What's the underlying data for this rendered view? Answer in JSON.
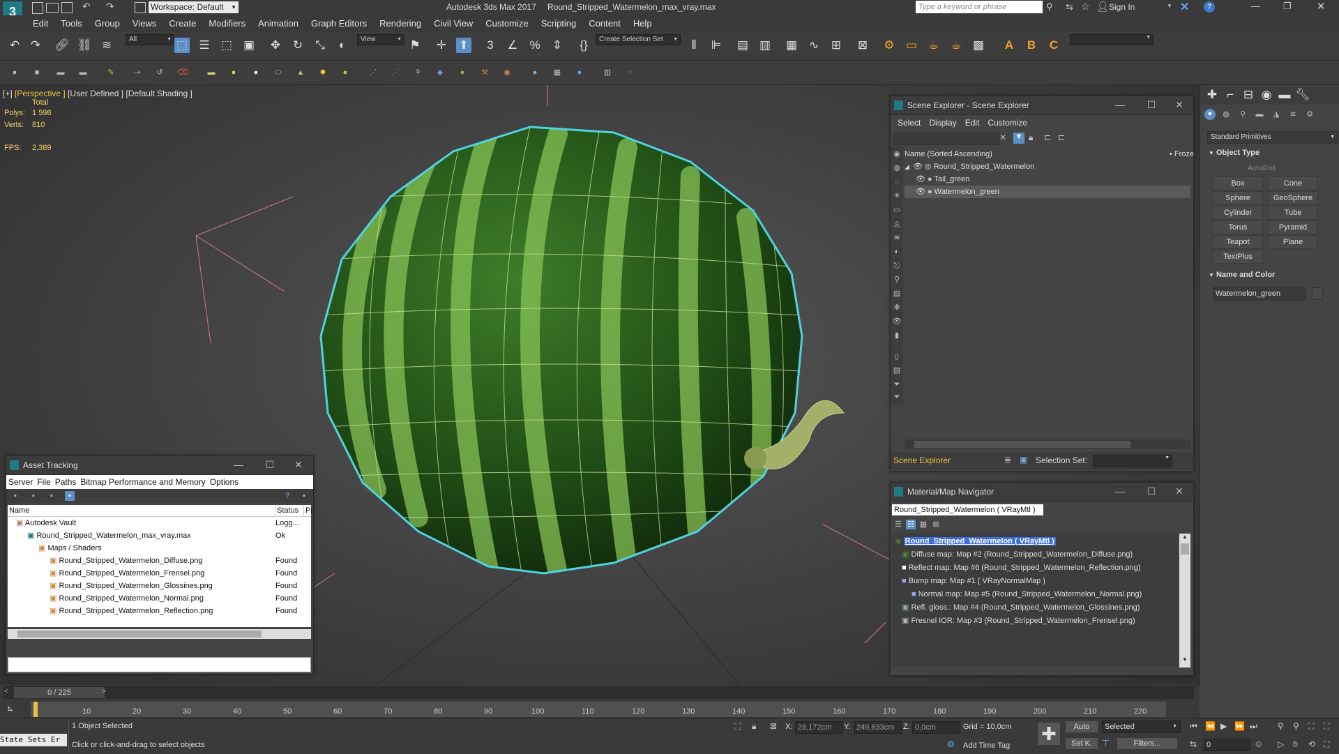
{
  "title_bar": {
    "workspace": "Workspace: Default",
    "app_title": "Autodesk 3ds Max 2017",
    "file_name": "Round_Stripped_Watermelon_max_vray.max",
    "search_placeholder": "Type a keyword or phrase",
    "sign_in": "Sign In"
  },
  "menu": [
    "Edit",
    "Tools",
    "Group",
    "Views",
    "Create",
    "Modifiers",
    "Animation",
    "Graph Editors",
    "Rendering",
    "Civil View",
    "Customize",
    "Scripting",
    "Content",
    "Help"
  ],
  "toolbar": {
    "filter": "All",
    "view": "View",
    "selection_set": "Create Selection Set",
    "accent": "#5b8fc9"
  },
  "viewport": {
    "label_plus": "[+]",
    "label_view": "[Perspective ]",
    "label_user": "[User Defined ]",
    "label_shading": "[Default Shading ]",
    "total": "Total",
    "polys_label": "Polys:",
    "polys_value": "1 598",
    "verts_label": "Verts:",
    "verts_value": "810",
    "fps_label": "FPS:",
    "fps_value": "2,389",
    "selection_color": "#4fd3e0"
  },
  "scene_explorer": {
    "title": "Scene Explorer - Scene Explorer",
    "menu": [
      "Select",
      "Display",
      "Edit",
      "Customize"
    ],
    "column": "Name (Sorted Ascending)",
    "column2": "• Froze",
    "root": "Round_Stripped_Watermelon",
    "children": [
      "Tail_green",
      "Watermelon_green"
    ],
    "footer_label": "Scene Explorer",
    "selection_set_label": "Selection Set:"
  },
  "command_panel": {
    "dropdown": "Standard Primitives",
    "object_type": "Object Type",
    "autogrid": "AutoGrid",
    "buttons": [
      "Box",
      "Cone",
      "Sphere",
      "GeoSphere",
      "Cylinder",
      "Tube",
      "Torus",
      "Pyramid",
      "Teapot",
      "Plane",
      "TextPlus"
    ],
    "name_color": "Name and Color",
    "object_name": "Watermelon_green"
  },
  "asset_tracking": {
    "title": "Asset Tracking",
    "menu": [
      "Server",
      "File",
      "Paths",
      "Bitmap Performance and Memory",
      "Options"
    ],
    "col_name": "Name",
    "col_status": "Status",
    "col_p": "Pr",
    "rows": [
      {
        "name": "Autodesk Vault",
        "status": "Logg..."
      },
      {
        "name": "Round_Stripped_Watermelon_max_vray.max",
        "status": "Ok"
      },
      {
        "name": "Maps / Shaders",
        "status": ""
      },
      {
        "name": "Round_Stripped_Watermelon_Diffuse.png",
        "status": "Found"
      },
      {
        "name": "Round_Stripped_Watermelon_Frensel.png",
        "status": "Found"
      },
      {
        "name": "Round_Stripped_Watermelon_Glossines.png",
        "status": "Found"
      },
      {
        "name": "Round_Stripped_Watermelon_Normal.png",
        "status": "Found"
      },
      {
        "name": "Round_Stripped_Watermelon_Reflection.png",
        "status": "Found"
      }
    ]
  },
  "material_navigator": {
    "title": "Material/Map Navigator",
    "current": "Round_Stripped_Watermelon  ( VRayMtl )",
    "root": "Round_Stripped_Watermelon  ( VRayMtl )",
    "items": [
      "Diffuse map: Map #2 (Round_Stripped_Watermelon_Diffuse.png)",
      "Reflect map: Map #6 (Round_Stripped_Watermelon_Reflection.png)",
      "Bump map: Map #1  ( VRayNormalMap )",
      "Normal map: Map #5 (Round_Stripped_Watermelon_Normal.png)",
      "Refl. gloss.: Map #4 (Round_Stripped_Watermelon_Glossines.png)",
      "Fresnel IOR: Map #3 (Round_Stripped_Watermelon_Frensel.png)"
    ]
  },
  "timeline": {
    "frame": "0 / 225",
    "ticks": [
      "10",
      "20",
      "30",
      "40",
      "50",
      "60",
      "70",
      "80",
      "90",
      "100",
      "110",
      "120",
      "130",
      "140",
      "150",
      "160",
      "170",
      "180",
      "190",
      "200",
      "210",
      "220"
    ]
  },
  "status": {
    "state_sets": "State Sets Er",
    "selected": "1 Object Selected",
    "hint": "Click or click-and-drag to select objects",
    "x_label": "X:",
    "x_value": "28,172cm",
    "y_label": "Y:",
    "y_value": "249,633cm",
    "z_label": "Z:",
    "z_value": "0,0cm",
    "grid": "Grid = 10,0cm",
    "add_time_tag": "Add Time Tag",
    "auto": "Auto",
    "selected_dropdown": "Selected",
    "set_k": "Set K.",
    "filters": "Filters...",
    "frame_value": "0"
  }
}
